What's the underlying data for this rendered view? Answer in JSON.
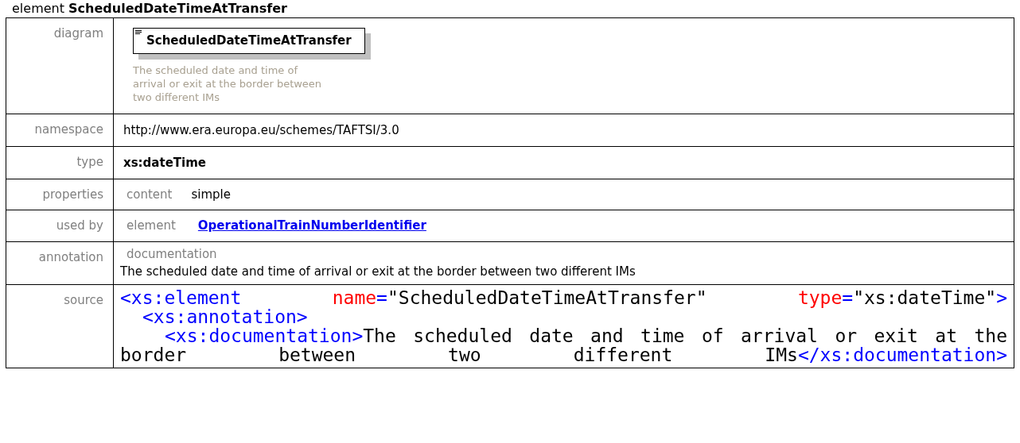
{
  "heading": {
    "kind": "element",
    "name": "ScheduledDateTimeAtTransfer"
  },
  "rows": [
    {
      "label": "diagram",
      "kind": "diagram",
      "box_title": "ScheduledDateTimeAtTransfer",
      "description": "The scheduled date and time of arrival or exit at the border between two different IMs"
    },
    {
      "label": "namespace",
      "kind": "plain",
      "value": "http://www.era.europa.eu/schemes/TAFTSI/3.0"
    },
    {
      "label": "type",
      "kind": "bold",
      "value": "xs:dateTime"
    },
    {
      "label": "properties",
      "kind": "pair",
      "key": "content",
      "value": "simple"
    },
    {
      "label": "used by",
      "kind": "link",
      "key": "element",
      "value": "OperationalTrainNumberIdentifier"
    },
    {
      "label": "annotation",
      "kind": "doc",
      "key": "documentation",
      "value": "The scheduled date and time of arrival or exit at the border between two different IMs"
    },
    {
      "label": "source",
      "kind": "source",
      "lines": [
        {
          "groups": [
            [
              {
                "kind": "tag",
                "text": "<xs:element"
              }
            ],
            [
              {
                "kind": "attr",
                "text": "name"
              },
              {
                "kind": "tag",
                "text": "="
              },
              {
                "kind": "text",
                "text": "\"ScheduledDateTimeAtTransfer\""
              }
            ],
            [
              {
                "kind": "attr",
                "text": "type"
              },
              {
                "kind": "tag",
                "text": "="
              },
              {
                "kind": "text",
                "text": "\"xs:dateTime\""
              },
              {
                "kind": "tag",
                "text": ">"
              }
            ]
          ],
          "children": [
            {
              "groups": [
                [
                  {
                    "kind": "tag",
                    "text": "<xs:annotation>"
                  }
                ]
              ],
              "children": [
                {
                  "groups": [
                    [
                      {
                        "kind": "tag",
                        "text": "<xs:documentation>"
                      },
                      {
                        "kind": "text",
                        "text": "The scheduled date and time of arrival or exit at the border between two different IMs"
                      },
                      {
                        "kind": "tag",
                        "text": "</xs:documentation>"
                      }
                    ]
                  ]
                }
              ]
            }
          ]
        }
      ]
    }
  ]
}
